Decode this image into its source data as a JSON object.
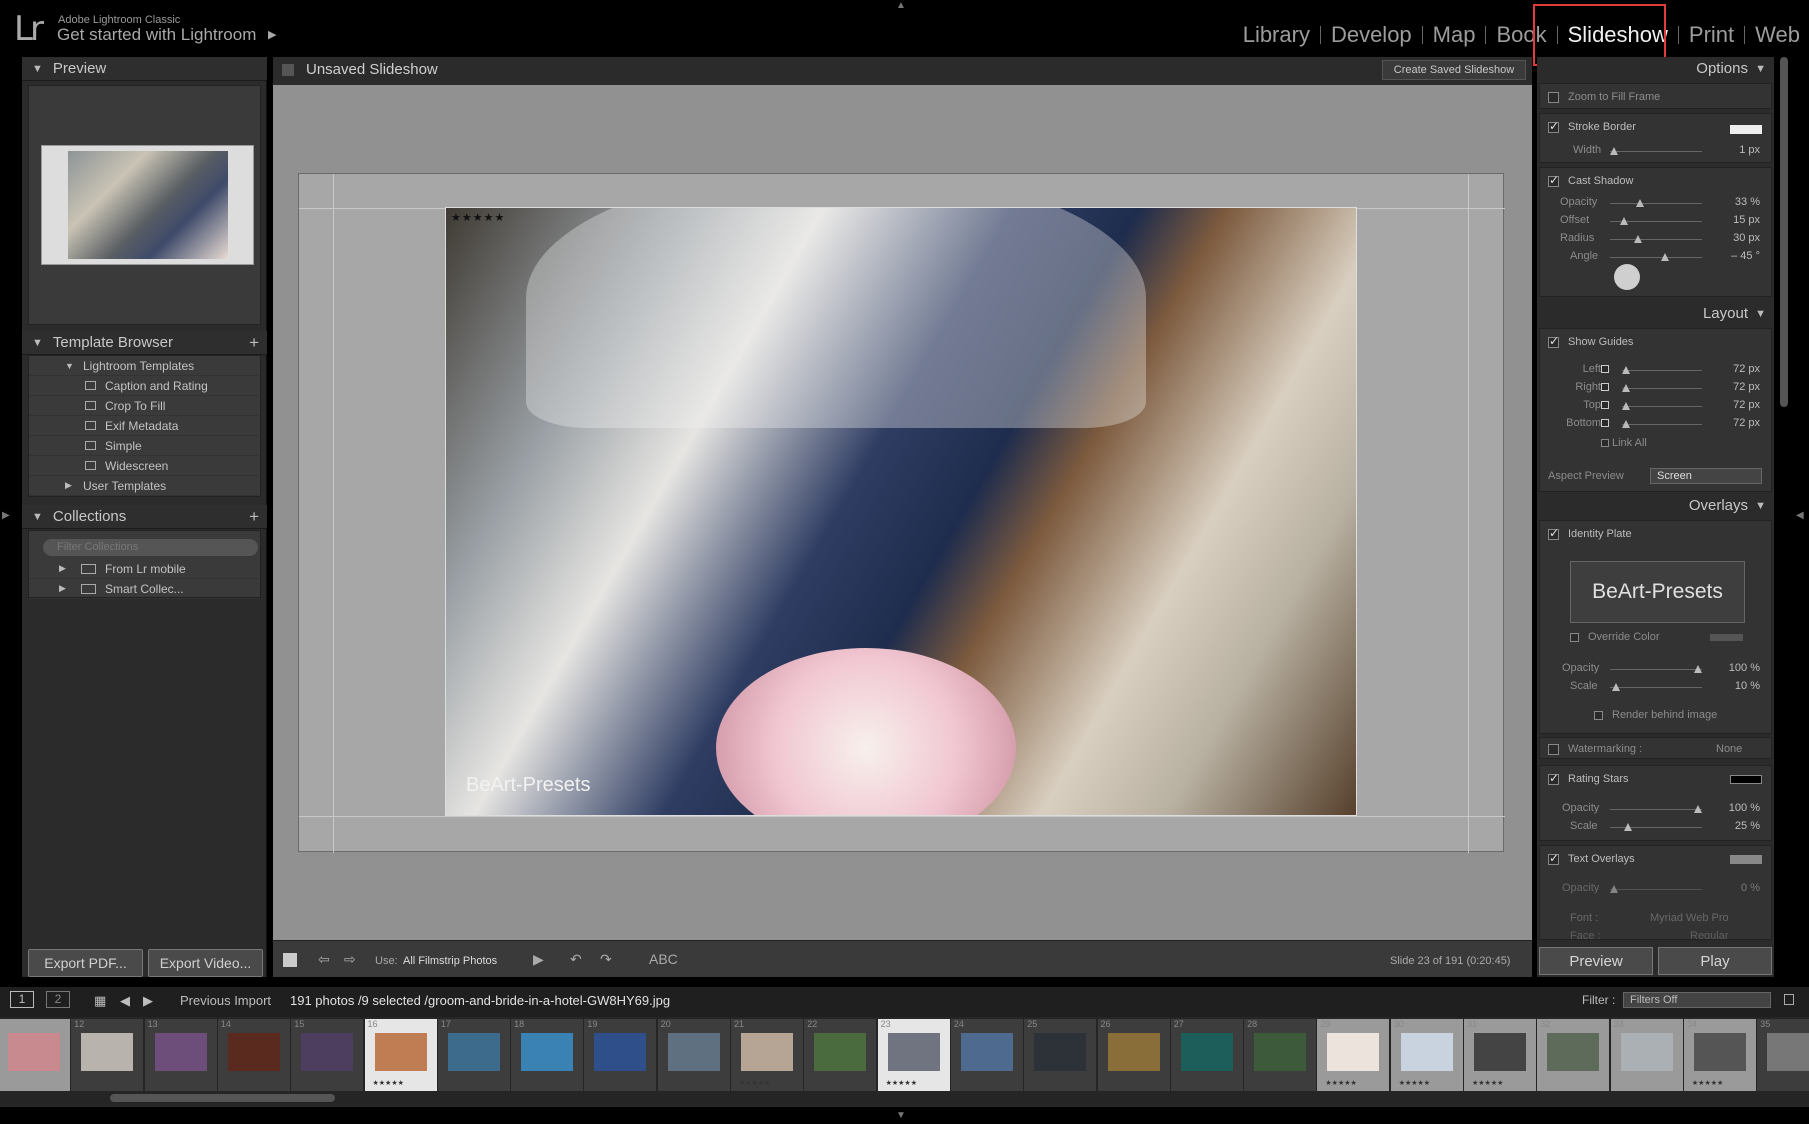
{
  "app": {
    "logo": "Lr",
    "name": "Adobe Lightroom Classic",
    "identity": "Get started with Lightroom",
    "identity_arrow": "▶"
  },
  "modules": [
    {
      "label": "Library"
    },
    {
      "label": "Develop"
    },
    {
      "label": "Map"
    },
    {
      "label": "Book"
    },
    {
      "label": "Slideshow",
      "active": true
    },
    {
      "label": "Print"
    },
    {
      "label": "Web"
    }
  ],
  "left": {
    "preview_title": "Preview",
    "template_browser_title": "Template Browser",
    "templates": [
      {
        "label": "Lightroom Templates"
      },
      {
        "label": "Caption and Rating"
      },
      {
        "label": "Crop To Fill"
      },
      {
        "label": "Exif Metadata"
      },
      {
        "label": "Simple"
      },
      {
        "label": "Widescreen"
      },
      {
        "label": "User Templates"
      }
    ],
    "collections_title": "Collections",
    "filter_placeholder": "Filter Collections",
    "collections": [
      {
        "label": "From Lr mobile"
      },
      {
        "label": "Smart Collec..."
      }
    ],
    "export_pdf": "Export PDF...",
    "export_video": "Export Video..."
  },
  "center": {
    "title": "Unsaved Slideshow",
    "create_saved": "Create Saved Slideshow",
    "rating_stars": "★★★★★",
    "identity_overlay": "BeArt-Presets",
    "toolbar": {
      "use_label": "Use:",
      "use_value": "All Filmstrip Photos",
      "abc": "ABC",
      "slide_info": "Slide 23 of 191 (0:20:45)"
    }
  },
  "right": {
    "options_title": "Options",
    "zoom_to_fill": "Zoom to Fill Frame",
    "stroke_border": "Stroke Border",
    "width_label": "Width",
    "width_value": "1 px",
    "cast_shadow": "Cast Shadow",
    "shadow": [
      {
        "label": "Opacity",
        "value": "33 %",
        "level": 0.33
      },
      {
        "label": "Offset",
        "value": "15 px",
        "level": 0.15
      },
      {
        "label": "Radius",
        "value": "30 px",
        "level": 0.3
      },
      {
        "label": "Angle",
        "value": "– 45 °",
        "level": 0.6
      }
    ],
    "layout_title": "Layout",
    "show_guides": "Show Guides",
    "guides": [
      {
        "label": "Left",
        "value": "72 px"
      },
      {
        "label": "Right",
        "value": "72 px"
      },
      {
        "label": "Top",
        "value": "72 px"
      },
      {
        "label": "Bottom",
        "value": "72 px"
      }
    ],
    "link_all": "Link All",
    "aspect_preview_label": "Aspect Preview",
    "aspect_preview_value": "Screen",
    "overlays_title": "Overlays",
    "identity_plate": "Identity Plate",
    "identity_plate_text": "BeArt-Presets",
    "override_color": "Override Color",
    "ip_opacity_label": "Opacity",
    "ip_opacity_value": "100 %",
    "ip_scale_label": "Scale",
    "ip_scale_value": "10 %",
    "render_behind": "Render behind image",
    "watermarking_label": "Watermarking :",
    "watermarking_value": "None",
    "rating_stars": "Rating Stars",
    "rs_opacity_label": "Opacity",
    "rs_opacity_value": "100 %",
    "rs_scale_label": "Scale",
    "rs_scale_value": "25 %",
    "text_overlays": "Text Overlays",
    "to_opacity_label": "Opacity",
    "to_opacity_value": "0 %",
    "font_label": "Font :",
    "font_value": "Myriad Web Pro",
    "face_label": "Face :",
    "face_value": "Regular",
    "preview_btn": "Preview",
    "play_btn": "Play"
  },
  "filmstrip": {
    "page1": "1",
    "page2": "2",
    "source": "Previous Import",
    "info": "191 photos /9 selected /groom-and-bride-in-a-hotel-GW8HY69.jpg",
    "filter_label": "Filter :",
    "filter_value": "Filters Off",
    "cells": [
      {
        "num": "",
        "stars": "",
        "state": "sel",
        "color": "#c98a8f"
      },
      {
        "num": "12",
        "stars": "",
        "state": "",
        "color": "#b9b3ad"
      },
      {
        "num": "13",
        "stars": "",
        "state": "",
        "color": "#6d4d7a"
      },
      {
        "num": "14",
        "stars": "",
        "state": "",
        "color": "#5a2a1e"
      },
      {
        "num": "15",
        "stars": "",
        "state": "",
        "color": "#4d3d5f"
      },
      {
        "num": "16",
        "stars": "★★★★★",
        "state": "cur",
        "color": "#c07c52"
      },
      {
        "num": "17",
        "stars": "",
        "state": "",
        "color": "#3d6b8c"
      },
      {
        "num": "18",
        "stars": "",
        "state": "",
        "color": "#3a82b4"
      },
      {
        "num": "19",
        "stars": "",
        "state": "",
        "color": "#2f4f8a"
      },
      {
        "num": "20",
        "stars": "",
        "state": "",
        "color": "#5f7080"
      },
      {
        "num": "21",
        "stars": "★★★★★",
        "state": "",
        "color": "#b6a595"
      },
      {
        "num": "22",
        "stars": "",
        "state": "",
        "color": "#4a6b3d"
      },
      {
        "num": "23",
        "stars": "★★★★★",
        "state": "cur",
        "color": "#6f7480"
      },
      {
        "num": "24",
        "stars": "",
        "state": "",
        "color": "#4f6a8f"
      },
      {
        "num": "25",
        "stars": "",
        "state": "",
        "color": "#2d3238"
      },
      {
        "num": "26",
        "stars": "",
        "state": "",
        "color": "#8a6e3a"
      },
      {
        "num": "27",
        "stars": "",
        "state": "",
        "color": "#1e5e5a"
      },
      {
        "num": "28",
        "stars": "",
        "state": "",
        "color": "#3d5a3a"
      },
      {
        "num": "29",
        "stars": "★★★★★",
        "state": "sel",
        "color": "#ece4dc"
      },
      {
        "num": "30",
        "stars": "★★★★★",
        "state": "sel",
        "color": "#c9d3df"
      },
      {
        "num": "31",
        "stars": "★★★★★",
        "state": "sel",
        "color": "#444"
      },
      {
        "num": "32",
        "stars": "",
        "state": "sel",
        "color": "#5e6a5a"
      },
      {
        "num": "33",
        "stars": "",
        "state": "sel",
        "color": "#aab0b4"
      },
      {
        "num": "34",
        "stars": "★★★★★",
        "state": "sel",
        "color": "#555"
      },
      {
        "num": "35",
        "stars": "",
        "state": "",
        "color": "#777"
      }
    ]
  }
}
